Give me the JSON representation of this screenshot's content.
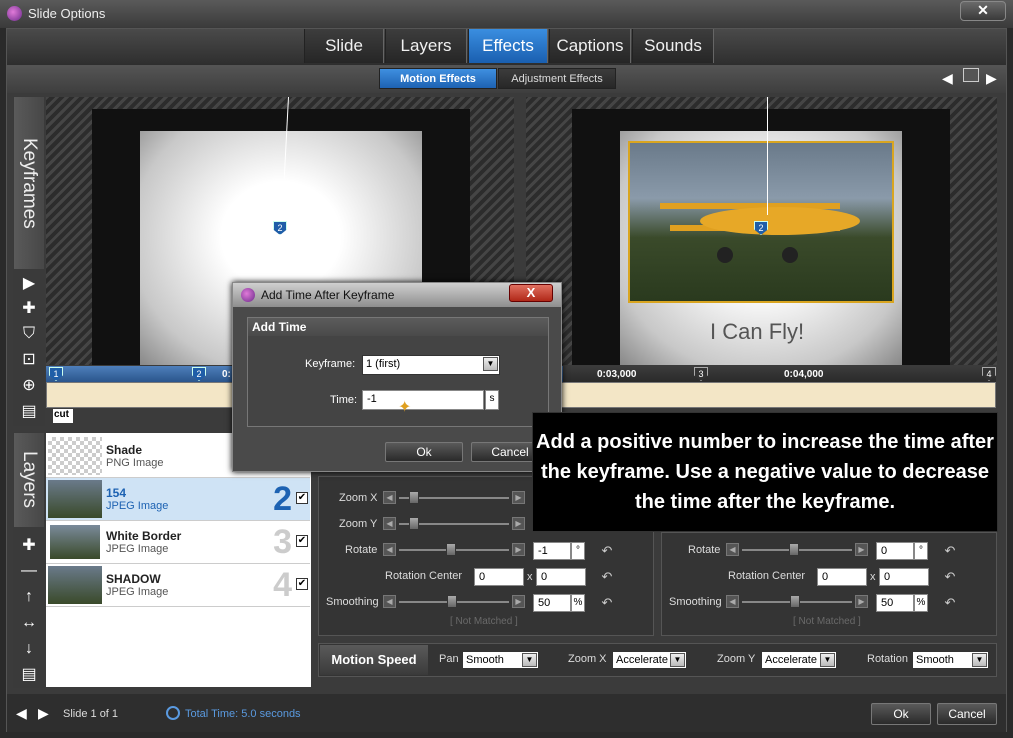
{
  "window": {
    "title": "Slide Options",
    "close_label": "✕"
  },
  "tabs": [
    {
      "label": "Slide",
      "active": false
    },
    {
      "label": "Layers",
      "active": false
    },
    {
      "label": "Effects",
      "active": true
    },
    {
      "label": "Captions",
      "active": false
    },
    {
      "label": "Sounds",
      "active": false
    }
  ],
  "subtabs": [
    {
      "label": "Motion Effects",
      "active": true
    },
    {
      "label": "Adjustment Effects",
      "active": false
    }
  ],
  "keyframes": {
    "vertical_label": "Keyframes",
    "marker_left": "2",
    "marker_right": "2",
    "caption_text": "I Can Fly!",
    "timeline": {
      "markers": [
        "1",
        "2",
        "3",
        "4"
      ],
      "labels": [
        "0:03,000",
        "0:04,000"
      ],
      "cut_label": "cut",
      "left_label": "0:"
    }
  },
  "layers": {
    "vertical_label": "Layers",
    "items": [
      {
        "name": "Shade",
        "type": "PNG Image",
        "number": "",
        "checked": false,
        "selected": false
      },
      {
        "name": "154",
        "type": "JPEG Image",
        "number": "2",
        "checked": true,
        "selected": true
      },
      {
        "name": "White Border",
        "type": "JPEG Image",
        "number": "3",
        "checked": true,
        "selected": false
      },
      {
        "name": "SHADOW",
        "type": "JPEG Image",
        "number": "4",
        "checked": true,
        "selected": false
      }
    ]
  },
  "left_panel": {
    "zoom_x_label": "Zoom X",
    "zoom_y_label": "Zoom Y",
    "rotate_label": "Rotate",
    "rotate_value": "-1",
    "rotate_unit": "°",
    "rotation_center_label": "Rotation Center",
    "rc_x": "0",
    "rc_sep": "x",
    "rc_y": "0",
    "smoothing_label": "Smoothing",
    "smoothing_value": "50",
    "smoothing_unit": "%",
    "not_matched": "[ Not Matched ]"
  },
  "right_panel": {
    "rotate_label": "Rotate",
    "rotate_value": "0",
    "rotate_unit": "°",
    "rotation_center_label": "Rotation Center",
    "rc_x": "0",
    "rc_sep": "x",
    "rc_y": "0",
    "smoothing_label": "Smoothing",
    "smoothing_value": "50",
    "smoothing_unit": "%",
    "not_matched": "[ Not Matched ]"
  },
  "motion_speed": {
    "label": "Motion Speed",
    "pan_label": "Pan",
    "pan_value": "Smooth",
    "zoom_x_label": "Zoom X",
    "zoom_x_value": "Accelerate",
    "zoom_y_label": "Zoom Y",
    "zoom_y_value": "Accelerate",
    "rotation_label": "Rotation",
    "rotation_value": "Smooth"
  },
  "dialog": {
    "title": "Add Time After Keyframe",
    "close_label": "X",
    "group_label": "Add Time",
    "keyframe_label": "Keyframe:",
    "keyframe_value": "1 (first)",
    "time_label": "Time:",
    "time_value": "-1",
    "time_unit": "s",
    "ok_label": "Ok",
    "cancel_label": "Cancel"
  },
  "callout": {
    "line1": "Add a positive number to increase the time after",
    "line2": "the keyframe.  Use a negative value to decrease",
    "line3": "the time after the keyframe."
  },
  "footer": {
    "slide_label": "Slide 1 of 1",
    "total_time": "Total Time: 5.0 seconds",
    "ok_label": "Ok",
    "cancel_label": "Cancel"
  },
  "colors": {
    "accent": "#1d62b2",
    "timeline": "#f3e6c6",
    "callout_bg": "#000000"
  }
}
